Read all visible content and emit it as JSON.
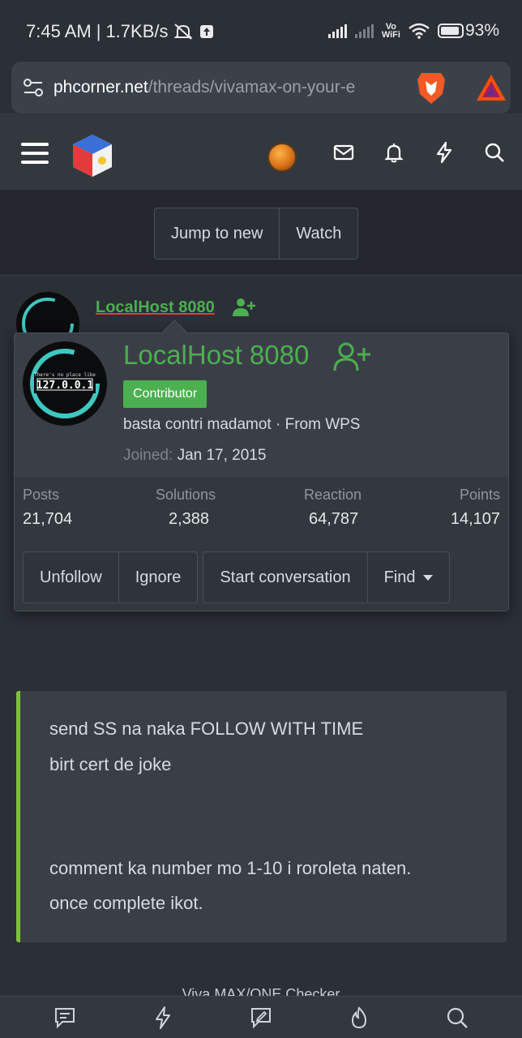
{
  "status_bar": {
    "time": "7:45 AM",
    "speed": "1.7KB/s",
    "vo": "Vo",
    "wifi_text": "WiFi",
    "battery": "93%"
  },
  "browser": {
    "url_host": "phcorner.net",
    "url_path": "/threads/vivamax-on-your-e"
  },
  "toolbar": {
    "jump_to_new": "Jump to new",
    "watch": "Watch"
  },
  "post_header": {
    "author": "LocalHost 8080"
  },
  "member_card": {
    "name": "LocalHost 8080",
    "badge": "Contributor",
    "title": "basta contri madamot · From WPS",
    "joined_label": "Joined:",
    "joined_value": "Jan 17, 2015",
    "avatar_text": "127.0.0.1",
    "avatar_small_text": "There's no place like",
    "stats": [
      {
        "label": "Posts",
        "value": "21,704"
      },
      {
        "label": "Solutions",
        "value": "2,388"
      },
      {
        "label": "Reaction",
        "value": "64,787"
      },
      {
        "label": "Points",
        "value": "14,107"
      }
    ],
    "actions": {
      "unfollow": "Unfollow",
      "ignore": "Ignore",
      "start_conversation": "Start conversation",
      "find": "Find"
    }
  },
  "post_body": {
    "line1": "send SS na naka FOLLOW WITH TIME",
    "line2": "birt cert de joke",
    "line3": "comment ka number mo 1-10 i roroleta naten.",
    "line4": "once complete ikot."
  },
  "footer_peek": "Viva MAX/ONE Checker",
  "colors": {
    "accent_green": "#4caf50",
    "quote_bar": "#7cc13e",
    "background": "#2b2f36"
  }
}
